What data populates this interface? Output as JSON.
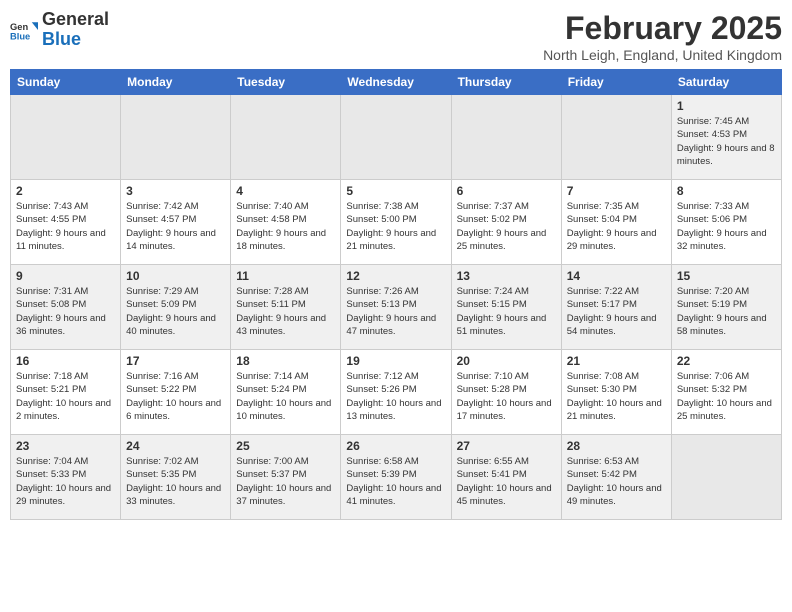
{
  "logo": {
    "line1": "General",
    "line2": "Blue"
  },
  "title": "February 2025",
  "location": "North Leigh, England, United Kingdom",
  "weekdays": [
    "Sunday",
    "Monday",
    "Tuesday",
    "Wednesday",
    "Thursday",
    "Friday",
    "Saturday"
  ],
  "weeks": [
    [
      {
        "day": "",
        "info": ""
      },
      {
        "day": "",
        "info": ""
      },
      {
        "day": "",
        "info": ""
      },
      {
        "day": "",
        "info": ""
      },
      {
        "day": "",
        "info": ""
      },
      {
        "day": "",
        "info": ""
      },
      {
        "day": "1",
        "info": "Sunrise: 7:45 AM\nSunset: 4:53 PM\nDaylight: 9 hours and 8 minutes."
      }
    ],
    [
      {
        "day": "2",
        "info": "Sunrise: 7:43 AM\nSunset: 4:55 PM\nDaylight: 9 hours and 11 minutes."
      },
      {
        "day": "3",
        "info": "Sunrise: 7:42 AM\nSunset: 4:57 PM\nDaylight: 9 hours and 14 minutes."
      },
      {
        "day": "4",
        "info": "Sunrise: 7:40 AM\nSunset: 4:58 PM\nDaylight: 9 hours and 18 minutes."
      },
      {
        "day": "5",
        "info": "Sunrise: 7:38 AM\nSunset: 5:00 PM\nDaylight: 9 hours and 21 minutes."
      },
      {
        "day": "6",
        "info": "Sunrise: 7:37 AM\nSunset: 5:02 PM\nDaylight: 9 hours and 25 minutes."
      },
      {
        "day": "7",
        "info": "Sunrise: 7:35 AM\nSunset: 5:04 PM\nDaylight: 9 hours and 29 minutes."
      },
      {
        "day": "8",
        "info": "Sunrise: 7:33 AM\nSunset: 5:06 PM\nDaylight: 9 hours and 32 minutes."
      }
    ],
    [
      {
        "day": "9",
        "info": "Sunrise: 7:31 AM\nSunset: 5:08 PM\nDaylight: 9 hours and 36 minutes."
      },
      {
        "day": "10",
        "info": "Sunrise: 7:29 AM\nSunset: 5:09 PM\nDaylight: 9 hours and 40 minutes."
      },
      {
        "day": "11",
        "info": "Sunrise: 7:28 AM\nSunset: 5:11 PM\nDaylight: 9 hours and 43 minutes."
      },
      {
        "day": "12",
        "info": "Sunrise: 7:26 AM\nSunset: 5:13 PM\nDaylight: 9 hours and 47 minutes."
      },
      {
        "day": "13",
        "info": "Sunrise: 7:24 AM\nSunset: 5:15 PM\nDaylight: 9 hours and 51 minutes."
      },
      {
        "day": "14",
        "info": "Sunrise: 7:22 AM\nSunset: 5:17 PM\nDaylight: 9 hours and 54 minutes."
      },
      {
        "day": "15",
        "info": "Sunrise: 7:20 AM\nSunset: 5:19 PM\nDaylight: 9 hours and 58 minutes."
      }
    ],
    [
      {
        "day": "16",
        "info": "Sunrise: 7:18 AM\nSunset: 5:21 PM\nDaylight: 10 hours and 2 minutes."
      },
      {
        "day": "17",
        "info": "Sunrise: 7:16 AM\nSunset: 5:22 PM\nDaylight: 10 hours and 6 minutes."
      },
      {
        "day": "18",
        "info": "Sunrise: 7:14 AM\nSunset: 5:24 PM\nDaylight: 10 hours and 10 minutes."
      },
      {
        "day": "19",
        "info": "Sunrise: 7:12 AM\nSunset: 5:26 PM\nDaylight: 10 hours and 13 minutes."
      },
      {
        "day": "20",
        "info": "Sunrise: 7:10 AM\nSunset: 5:28 PM\nDaylight: 10 hours and 17 minutes."
      },
      {
        "day": "21",
        "info": "Sunrise: 7:08 AM\nSunset: 5:30 PM\nDaylight: 10 hours and 21 minutes."
      },
      {
        "day": "22",
        "info": "Sunrise: 7:06 AM\nSunset: 5:32 PM\nDaylight: 10 hours and 25 minutes."
      }
    ],
    [
      {
        "day": "23",
        "info": "Sunrise: 7:04 AM\nSunset: 5:33 PM\nDaylight: 10 hours and 29 minutes."
      },
      {
        "day": "24",
        "info": "Sunrise: 7:02 AM\nSunset: 5:35 PM\nDaylight: 10 hours and 33 minutes."
      },
      {
        "day": "25",
        "info": "Sunrise: 7:00 AM\nSunset: 5:37 PM\nDaylight: 10 hours and 37 minutes."
      },
      {
        "day": "26",
        "info": "Sunrise: 6:58 AM\nSunset: 5:39 PM\nDaylight: 10 hours and 41 minutes."
      },
      {
        "day": "27",
        "info": "Sunrise: 6:55 AM\nSunset: 5:41 PM\nDaylight: 10 hours and 45 minutes."
      },
      {
        "day": "28",
        "info": "Sunrise: 6:53 AM\nSunset: 5:42 PM\nDaylight: 10 hours and 49 minutes."
      },
      {
        "day": "",
        "info": ""
      }
    ]
  ]
}
